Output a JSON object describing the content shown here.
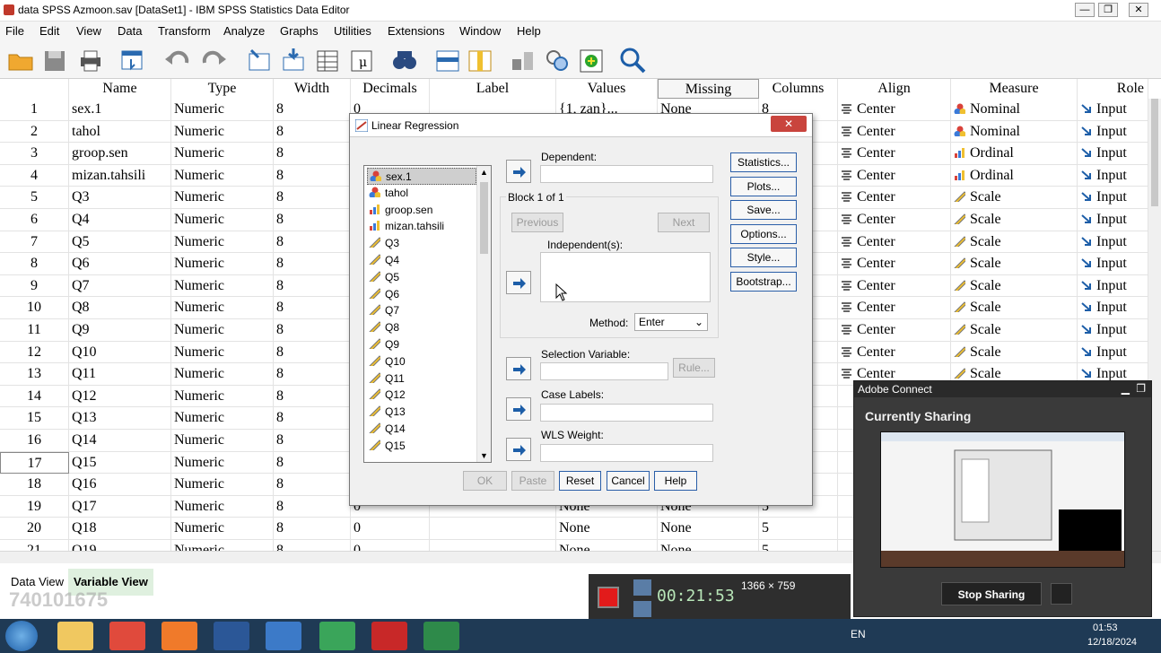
{
  "window": {
    "title": "data SPSS Azmoon.sav [DataSet1] - IBM SPSS Statistics Data Editor",
    "controls": [
      "—",
      "❐",
      "✕"
    ]
  },
  "menu": [
    "File",
    "Edit",
    "View",
    "Data",
    "Transform",
    "Analyze",
    "Graphs",
    "Utilities",
    "Extensions",
    "Window",
    "Help"
  ],
  "toolbar_icons": [
    "open-folder",
    "save",
    "print",
    "dialog-recall",
    "undo",
    "redo",
    "goto-case",
    "goto-variable",
    "variables",
    "run-descriptives",
    "find",
    "insert-cases",
    "insert-variable",
    "split-file",
    "weight-cases",
    "select-cases",
    "value-labels",
    "use-sets",
    "search"
  ],
  "grid": {
    "columns": [
      "Name",
      "Type",
      "Width",
      "Decimals",
      "Label",
      "Values",
      "Missing",
      "Columns",
      "Align",
      "Measure",
      "Role"
    ],
    "rows": [
      {
        "n": "1",
        "name": "sex.1",
        "type": "Numeric",
        "width": "8",
        "decimals": "0",
        "values": "{1, zan}...",
        "missing": "None",
        "columns": "8",
        "align": "Center",
        "measure": "Nominal",
        "role": "Input"
      },
      {
        "n": "2",
        "name": "tahol",
        "type": "Numeric",
        "width": "8",
        "decimals": "",
        "values": "",
        "missing": "",
        "columns": "",
        "align": "Center",
        "measure": "Nominal",
        "role": "Input"
      },
      {
        "n": "3",
        "name": "groop.sen",
        "type": "Numeric",
        "width": "8",
        "decimals": "",
        "values": "",
        "missing": "",
        "columns": "",
        "align": "Center",
        "measure": "Ordinal",
        "role": "Input"
      },
      {
        "n": "4",
        "name": "mizan.tahsili",
        "type": "Numeric",
        "width": "8",
        "decimals": "",
        "values": "",
        "missing": "",
        "columns": "",
        "align": "Center",
        "measure": "Ordinal",
        "role": "Input"
      },
      {
        "n": "5",
        "name": "Q3",
        "type": "Numeric",
        "width": "8",
        "decimals": "",
        "values": "",
        "missing": "",
        "columns": "",
        "align": "Center",
        "measure": "Scale",
        "role": "Input"
      },
      {
        "n": "6",
        "name": "Q4",
        "type": "Numeric",
        "width": "8",
        "decimals": "",
        "values": "",
        "missing": "",
        "columns": "",
        "align": "Center",
        "measure": "Scale",
        "role": "Input"
      },
      {
        "n": "7",
        "name": "Q5",
        "type": "Numeric",
        "width": "8",
        "decimals": "",
        "values": "",
        "missing": "",
        "columns": "",
        "align": "Center",
        "measure": "Scale",
        "role": "Input"
      },
      {
        "n": "8",
        "name": "Q6",
        "type": "Numeric",
        "width": "8",
        "decimals": "",
        "values": "",
        "missing": "",
        "columns": "",
        "align": "Center",
        "measure": "Scale",
        "role": "Input"
      },
      {
        "n": "9",
        "name": "Q7",
        "type": "Numeric",
        "width": "8",
        "decimals": "",
        "values": "",
        "missing": "",
        "columns": "",
        "align": "Center",
        "measure": "Scale",
        "role": "Input"
      },
      {
        "n": "10",
        "name": "Q8",
        "type": "Numeric",
        "width": "8",
        "decimals": "",
        "values": "",
        "missing": "",
        "columns": "",
        "align": "Center",
        "measure": "Scale",
        "role": "Input"
      },
      {
        "n": "11",
        "name": "Q9",
        "type": "Numeric",
        "width": "8",
        "decimals": "",
        "values": "",
        "missing": "",
        "columns": "",
        "align": "Center",
        "measure": "Scale",
        "role": "Input"
      },
      {
        "n": "12",
        "name": "Q10",
        "type": "Numeric",
        "width": "8",
        "decimals": "",
        "values": "",
        "missing": "",
        "columns": "",
        "align": "Center",
        "measure": "Scale",
        "role": "Input"
      },
      {
        "n": "13",
        "name": "Q11",
        "type": "Numeric",
        "width": "8",
        "decimals": "",
        "values": "",
        "missing": "",
        "columns": "",
        "align": "Center",
        "measure": "Scale",
        "role": "Input"
      },
      {
        "n": "14",
        "name": "Q12",
        "type": "Numeric",
        "width": "8",
        "decimals": "",
        "values": "",
        "missing": "",
        "columns": "",
        "align": "",
        "measure": "",
        "role": ""
      },
      {
        "n": "15",
        "name": "Q13",
        "type": "Numeric",
        "width": "8",
        "decimals": "",
        "values": "",
        "missing": "",
        "columns": "",
        "align": "",
        "measure": "",
        "role": ""
      },
      {
        "n": "16",
        "name": "Q14",
        "type": "Numeric",
        "width": "8",
        "decimals": "",
        "values": "",
        "missing": "",
        "columns": "",
        "align": "",
        "measure": "",
        "role": ""
      },
      {
        "n": "17",
        "name": "Q15",
        "type": "Numeric",
        "width": "8",
        "decimals": "",
        "values": "",
        "missing": "",
        "columns": "",
        "align": "",
        "measure": "",
        "role": ""
      },
      {
        "n": "18",
        "name": "Q16",
        "type": "Numeric",
        "width": "8",
        "decimals": "",
        "values": "",
        "missing": "",
        "columns": "",
        "align": "",
        "measure": "",
        "role": ""
      },
      {
        "n": "19",
        "name": "Q17",
        "type": "Numeric",
        "width": "8",
        "decimals": "0",
        "values": "None",
        "missing": "None",
        "columns": "5",
        "align": "",
        "measure": "",
        "role": ""
      },
      {
        "n": "20",
        "name": "Q18",
        "type": "Numeric",
        "width": "8",
        "decimals": "0",
        "values": "None",
        "missing": "None",
        "columns": "5",
        "align": "",
        "measure": "",
        "role": ""
      },
      {
        "n": "21",
        "name": "Q19",
        "type": "Numeric",
        "width": "8",
        "decimals": "0",
        "values": "None",
        "missing": "None",
        "columns": "5",
        "align": "",
        "measure": "",
        "role": ""
      }
    ]
  },
  "tabs": {
    "data_view": "Data View",
    "variable_view": "Variable View"
  },
  "watermark": "740101675",
  "dialog": {
    "title": "Linear Regression",
    "close": "✕",
    "variables": [
      "sex.1",
      "tahol",
      "groop.sen",
      "mizan.tahsili",
      "Q3",
      "Q4",
      "Q5",
      "Q6",
      "Q7",
      "Q8",
      "Q9",
      "Q10",
      "Q11",
      "Q12",
      "Q13",
      "Q14",
      "Q15"
    ],
    "dependent_label": "Dependent:",
    "block_label": "Block 1 of 1",
    "previous": "Previous",
    "next": "Next",
    "independent_label": "Independent(s):",
    "method_label": "Method:",
    "method_value": "Enter",
    "selection_label": "Selection Variable:",
    "rule": "Rule...",
    "case_labels": "Case Labels:",
    "wls_label": "WLS Weight:",
    "side_buttons": [
      "Statistics...",
      "Plots...",
      "Save...",
      "Options...",
      "Style...",
      "Bootstrap..."
    ],
    "bottom_buttons": {
      "ok": "OK",
      "paste": "Paste",
      "reset": "Reset",
      "cancel": "Cancel",
      "help": "Help"
    }
  },
  "adobe": {
    "title": "Adobe Connect",
    "heading": "Currently Sharing",
    "stop": "Stop Sharing"
  },
  "recorder": {
    "timer": "00:21:53",
    "resolution": "1366 × 759"
  },
  "taskbar": {
    "lang": "EN",
    "time": "01:53",
    "date": "12/18/2024"
  },
  "colors": {
    "accent_blue": "#2a5ea8",
    "close_red": "#c9443d",
    "taskbar": "#1f3a55"
  }
}
